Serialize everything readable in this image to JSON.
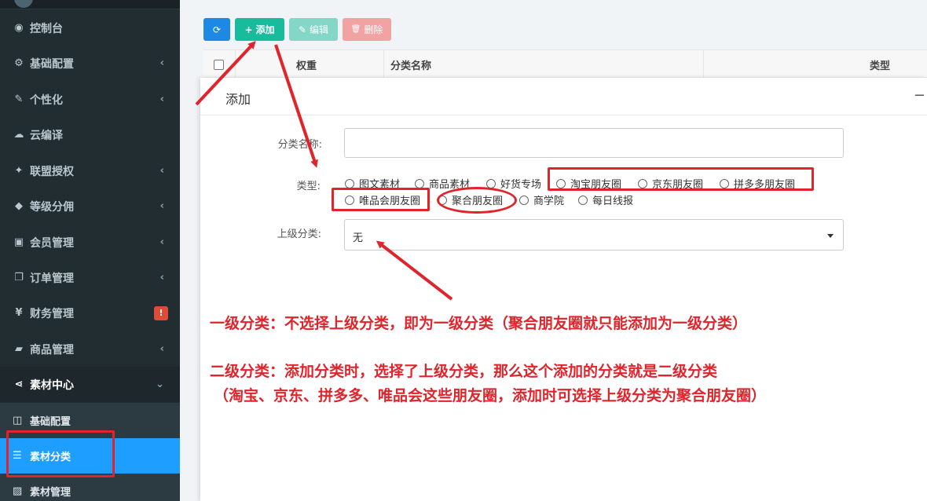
{
  "sidebar": {
    "items": [
      {
        "icon": "dashboard-icon",
        "glyph": "◉",
        "label": "控制台"
      },
      {
        "icon": "cogs-icon",
        "glyph": "⚙",
        "label": "基础配置",
        "chevron": "‹"
      },
      {
        "icon": "magic-wand-icon",
        "glyph": "✎",
        "label": "个性化",
        "chevron": "‹"
      },
      {
        "icon": "cloud-icon",
        "glyph": "☁",
        "label": "云编译"
      },
      {
        "icon": "users-icon",
        "glyph": "✦",
        "label": "联盟授权",
        "chevron": "‹"
      },
      {
        "icon": "diamond-icon",
        "glyph": "◆",
        "label": "等级分佣",
        "chevron": "‹"
      },
      {
        "icon": "member-card-icon",
        "glyph": "▣",
        "label": "会员管理",
        "chevron": "‹"
      },
      {
        "icon": "order-copy-icon",
        "glyph": "❐",
        "label": "订单管理",
        "chevron": "‹"
      },
      {
        "icon": "yen-icon",
        "glyph": "¥",
        "label": "财务管理",
        "badge": "!"
      },
      {
        "icon": "briefcase-icon",
        "glyph": "▰",
        "label": "商品管理",
        "chevron": "‹"
      },
      {
        "icon": "share-icon",
        "glyph": "⋖",
        "label": "素材中心",
        "chevron": "⌄"
      }
    ],
    "subitems": [
      {
        "icon": "columns-icon",
        "glyph": "◫",
        "label": "基础配置"
      },
      {
        "icon": "list-icon",
        "glyph": "☰",
        "label": "素材分类"
      },
      {
        "icon": "image-icon",
        "glyph": "▨",
        "label": "素材管理"
      }
    ]
  },
  "toolbar": {
    "refresh_glyph": "⟳",
    "add_glyph": "+",
    "add_label": "添加",
    "edit_glyph": "✎",
    "edit_label": "编辑",
    "delete_glyph": "🗑",
    "delete_label": "删除"
  },
  "table": {
    "columns": [
      "权重",
      "分类名称",
      "类型"
    ]
  },
  "modal": {
    "title": "添加",
    "minimize": "−",
    "name_label": "分类名称:",
    "name_value": "",
    "type_label": "类型:",
    "types": [
      "图文素材",
      "商品素材",
      "好货专场",
      "淘宝朋友圈",
      "京东朋友圈",
      "拼多多朋友圈",
      "唯品会朋友圈",
      "聚合朋友圈",
      "商学院",
      "每日线报"
    ],
    "parent_label": "上级分类:",
    "parent_value": "无"
  },
  "annotations": {
    "line1": "一级分类：不选择上级分类，即为一级分类（聚合朋友圈就只能添加为一级分类）",
    "line2": "二级分类：添加分类时，选择了上级分类，那么这个添加的分类就是二级分类",
    "line3": "（淘宝、京东、拼多多、唯品会这些朋友圈，添加时可选择上级分类为聚合朋友圈）"
  },
  "colors": {
    "sidebar_bg": "#222d32",
    "active_blue": "#1e9fff",
    "add_green": "#18bc9c",
    "annotation_red": "#e0242b",
    "badge_red": "#dd4b39"
  }
}
